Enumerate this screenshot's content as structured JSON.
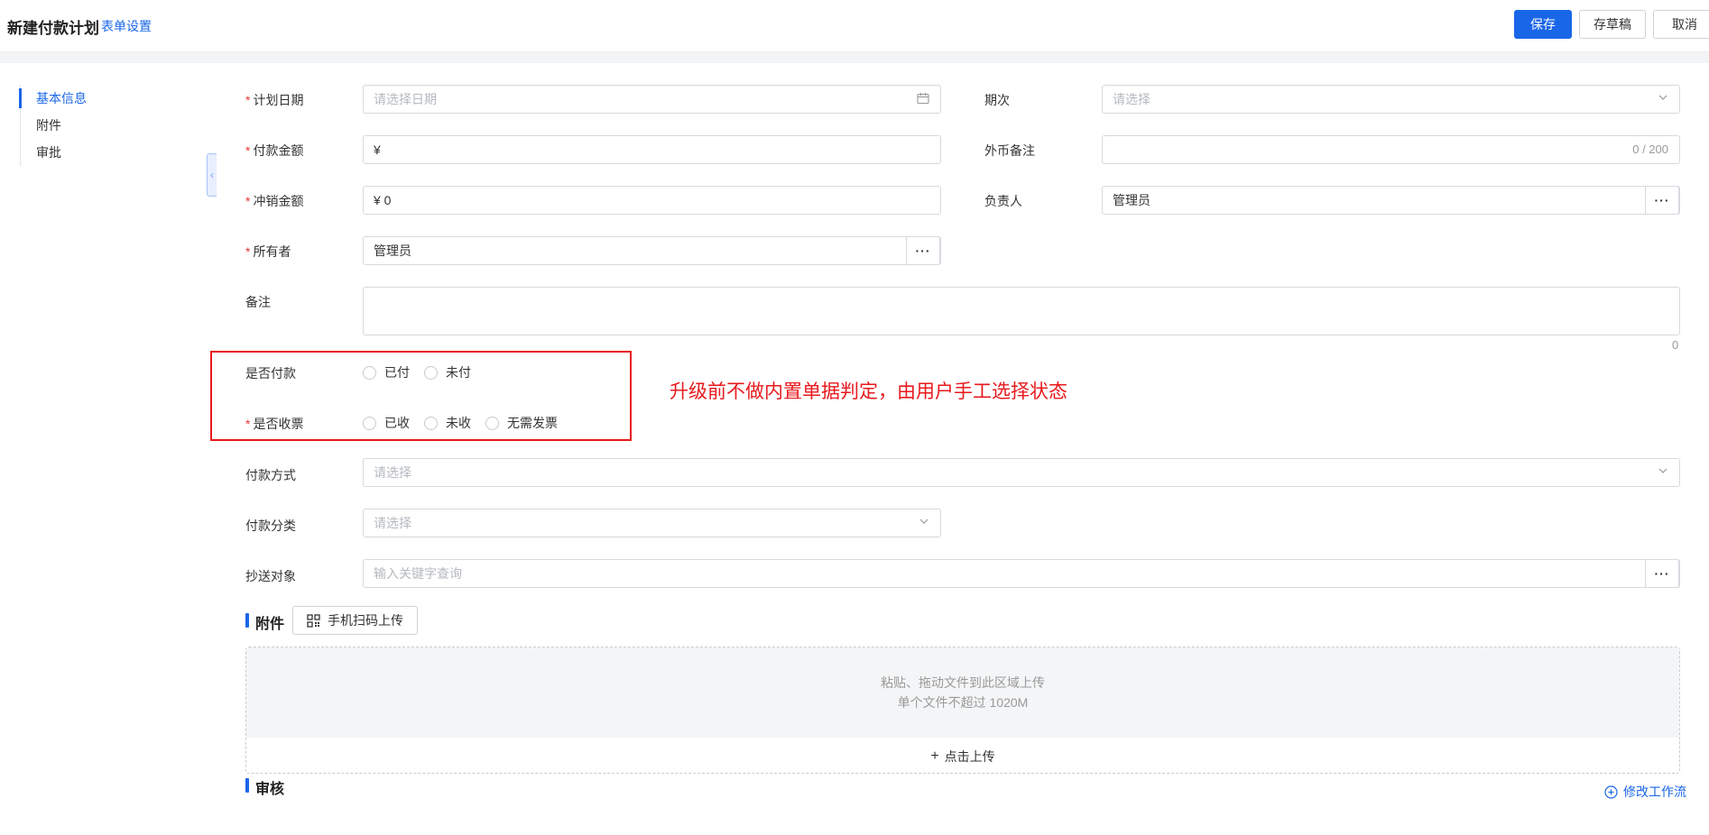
{
  "header": {
    "title": "新建付款计划",
    "settings_link": "表单设置",
    "save_label": "保存",
    "draft_label": "存草稿",
    "cancel_label": "取消"
  },
  "sidebar": {
    "items": [
      {
        "label": "基本信息",
        "active": true
      },
      {
        "label": "附件",
        "active": false
      },
      {
        "label": "审批",
        "active": false
      }
    ]
  },
  "form": {
    "plan_date": {
      "label": "计划日期",
      "required": true,
      "placeholder": "请选择日期",
      "icon": "calendar-icon"
    },
    "period": {
      "label": "期次",
      "required": false,
      "placeholder": "请选择",
      "icon": "chevron-down-icon"
    },
    "payment_amount": {
      "label": "付款金额",
      "required": true,
      "value": "¥"
    },
    "fx_note": {
      "label": "外币备注",
      "required": false,
      "counter": "0 / 200"
    },
    "writeoff_amount": {
      "label": "冲销金额",
      "required": true,
      "value": "¥ 0"
    },
    "manager": {
      "label": "负责人",
      "required": false,
      "value": "管理员",
      "more": "···"
    },
    "owner": {
      "label": "所有者",
      "required": true,
      "value": "管理员",
      "more": "···"
    },
    "remark": {
      "label": "备注",
      "required": false,
      "counter": "0"
    },
    "is_paid": {
      "label": "是否付款",
      "required": false,
      "options": [
        "已付",
        "未付"
      ]
    },
    "is_invoiced": {
      "label": "是否收票",
      "required": true,
      "options": [
        "已收",
        "未收",
        "无需发票"
      ]
    },
    "pay_method": {
      "label": "付款方式",
      "required": false,
      "placeholder": "请选择"
    },
    "pay_category": {
      "label": "付款分类",
      "required": false,
      "placeholder": "请选择"
    },
    "cc": {
      "label": "抄送对象",
      "required": false,
      "placeholder": "输入关键字查询",
      "more": "···"
    }
  },
  "annotation": "升级前不做内置单据判定，由用户手工选择状态",
  "attachments": {
    "title": "附件",
    "scan_label": "手机扫码上传",
    "drop_line1": "粘贴、拖动文件到此区域上传",
    "drop_line2": "单个文件不超过 1020M",
    "upload_label": "点击上传"
  },
  "approval": {
    "title": "审核",
    "workflow_link": "修改工作流"
  },
  "colors": {
    "accent": "#1a66e8",
    "required": "#e53935",
    "annotation": "#e8191d"
  }
}
